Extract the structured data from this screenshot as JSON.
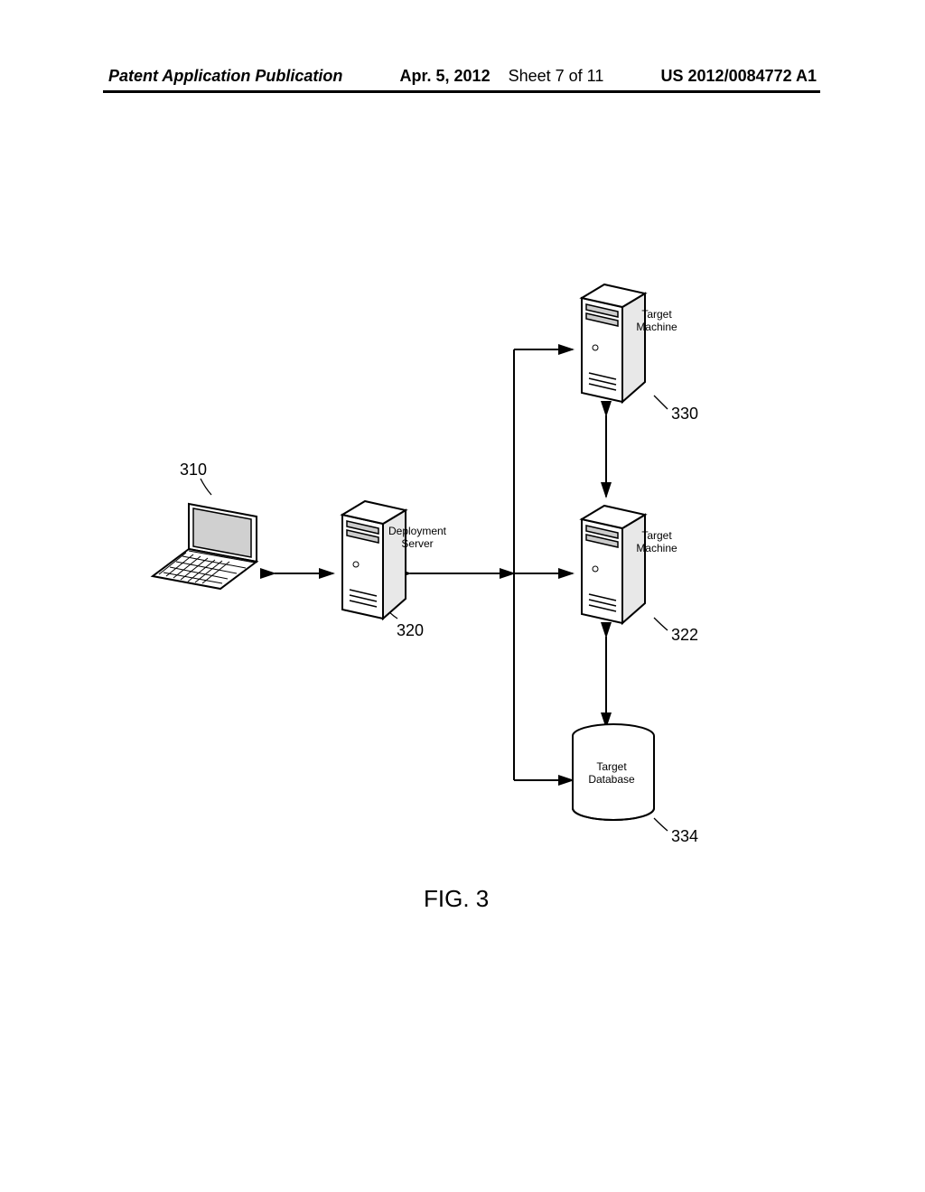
{
  "header": {
    "publication": "Patent Application Publication",
    "date": "Apr. 5, 2012",
    "sheet": "Sheet 7 of 11",
    "docnum": "US 2012/0084772 A1"
  },
  "figure": {
    "caption": "FIG. 3",
    "refs": {
      "laptop": "310",
      "deployment_server": "320",
      "target_machine_mid": "322",
      "target_machine_top": "330",
      "target_database": "334"
    },
    "labels": {
      "deployment_server": "Deployment\nServer",
      "target_machine_top": "Target\nMachine",
      "target_machine_mid": "Target\nMachine",
      "target_database": "Target\nDatabase"
    }
  }
}
